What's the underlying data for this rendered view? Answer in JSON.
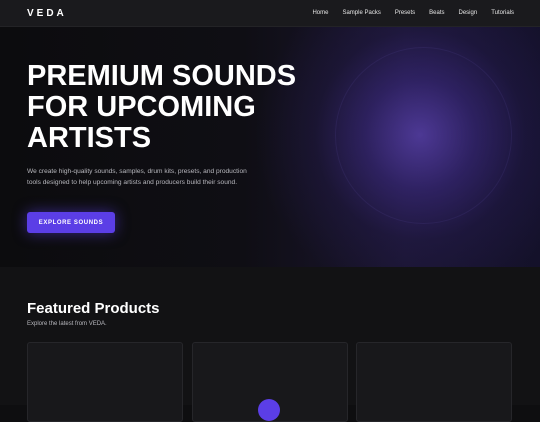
{
  "brand": {
    "logo": "VEDA"
  },
  "nav": {
    "items": [
      {
        "label": "Home"
      },
      {
        "label": "Sample Packs"
      },
      {
        "label": "Presets"
      },
      {
        "label": "Beats"
      },
      {
        "label": "Design"
      },
      {
        "label": "Tutorials"
      }
    ]
  },
  "hero": {
    "title": "PREMIUM SOUNDS FOR UPCOMING ARTISTS",
    "description": "We create high-quality sounds, samples, drum kits, presets, and production tools designed to help upcoming artists and producers build their sound.",
    "cta_label": "EXPLORE SOUNDS"
  },
  "featured": {
    "title": "Featured Products",
    "subtitle": "Explore the latest from VEDA."
  },
  "colors": {
    "accent": "#5b3ee6",
    "background": "#0e0e10",
    "nav_background": "#1a1a1d"
  }
}
